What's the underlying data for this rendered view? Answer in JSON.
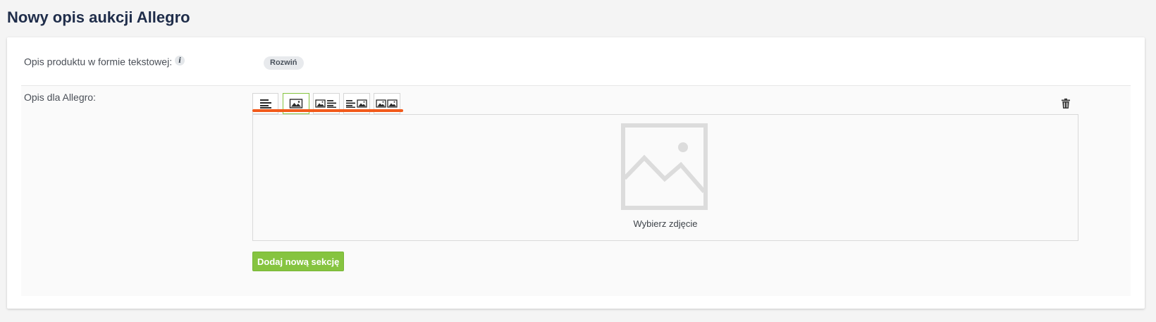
{
  "page": {
    "title": "Nowy opis aukcji Allegro"
  },
  "text_description": {
    "label": "Opis produktu w formie tekstowej:",
    "info_icon": "info-icon",
    "expand_label": "Rozwiń"
  },
  "allegro_description": {
    "label": "Opis dla Allegro:",
    "layout_options": [
      {
        "name": "text-only",
        "icon": "align-left-icon",
        "selected": false
      },
      {
        "name": "image-only",
        "icon": "image-icon",
        "selected": true
      },
      {
        "name": "image-text",
        "icon": "image-text-icon",
        "selected": false
      },
      {
        "name": "text-image",
        "icon": "text-image-icon",
        "selected": false
      },
      {
        "name": "image-image",
        "icon": "two-images-icon",
        "selected": false
      }
    ],
    "delete_icon": "trash-icon",
    "image_placeholder_label": "Wybierz zdjęcie",
    "add_section_label": "Dodaj nową sekcję"
  },
  "colors": {
    "accent_green": "#86c440",
    "accent_orange": "#f25a1b",
    "title_navy": "#1f2d4a"
  }
}
